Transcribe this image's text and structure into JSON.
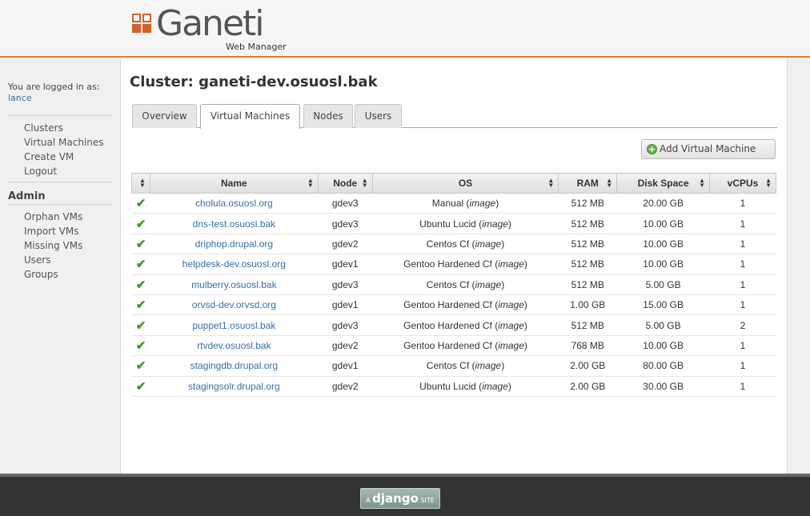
{
  "header": {
    "logo_title": "Ganeti",
    "logo_subtitle": "Web Manager"
  },
  "sidebar": {
    "login_text": "You are logged in as:",
    "username": "lance",
    "nav": [
      "Clusters",
      "Virtual Machines",
      "Create VM",
      "Logout"
    ],
    "admin_heading": "Admin",
    "admin_nav": [
      "Orphan VMs",
      "Import VMs",
      "Missing VMs",
      "Users",
      "Groups"
    ]
  },
  "main": {
    "title": "Cluster: ganeti-dev.osuosl.bak",
    "tabs": [
      {
        "label": "Overview",
        "active": false
      },
      {
        "label": "Virtual Machines",
        "active": true
      },
      {
        "label": "Nodes",
        "active": false
      },
      {
        "label": "Users",
        "active": false
      }
    ],
    "add_button_label": "Add Virtual Machine",
    "table": {
      "columns": [
        "",
        "Name",
        "Node",
        "OS",
        "RAM",
        "Disk Space",
        "vCPUs"
      ],
      "rows": [
        {
          "status": "running",
          "name": "cholula.osuosl.org",
          "node": "gdev3",
          "os": "Manual",
          "os_type": "image",
          "ram": "512 MB",
          "disk": "20.00 GB",
          "vcpus": "1"
        },
        {
          "status": "running",
          "name": "dns-test.osuosl.bak",
          "node": "gdev3",
          "os": "Ubuntu Lucid",
          "os_type": "image",
          "ram": "512 MB",
          "disk": "10.00 GB",
          "vcpus": "1"
        },
        {
          "status": "running",
          "name": "driphop.drupal.org",
          "node": "gdev2",
          "os": "Centos Cf",
          "os_type": "image",
          "ram": "512 MB",
          "disk": "10.00 GB",
          "vcpus": "1"
        },
        {
          "status": "running",
          "name": "helpdesk-dev.osuosl.org",
          "node": "gdev1",
          "os": "Gentoo Hardened Cf",
          "os_type": "image",
          "ram": "512 MB",
          "disk": "10.00 GB",
          "vcpus": "1"
        },
        {
          "status": "running",
          "name": "mulberry.osuosl.bak",
          "node": "gdev3",
          "os": "Centos Cf",
          "os_type": "image",
          "ram": "512 MB",
          "disk": "5.00 GB",
          "vcpus": "1"
        },
        {
          "status": "running",
          "name": "orvsd-dev.orvsd.org",
          "node": "gdev1",
          "os": "Gentoo Hardened Cf",
          "os_type": "image",
          "ram": "1.00 GB",
          "disk": "15.00 GB",
          "vcpus": "1"
        },
        {
          "status": "running",
          "name": "puppet1.osuosl.bak",
          "node": "gdev3",
          "os": "Gentoo Hardened Cf",
          "os_type": "image",
          "ram": "512 MB",
          "disk": "5.00 GB",
          "vcpus": "2"
        },
        {
          "status": "running",
          "name": "rtvdev.osuosl.bak",
          "node": "gdev2",
          "os": "Gentoo Hardened Cf",
          "os_type": "image",
          "ram": "768 MB",
          "disk": "10.00 GB",
          "vcpus": "1"
        },
        {
          "status": "running",
          "name": "stagingdb.drupal.org",
          "node": "gdev1",
          "os": "Centos Cf",
          "os_type": "image",
          "ram": "2.00 GB",
          "disk": "80.00 GB",
          "vcpus": "1"
        },
        {
          "status": "running",
          "name": "stagingsolr.drupal.org",
          "node": "gdev2",
          "os": "Ubuntu Lucid",
          "os_type": "image",
          "ram": "2.00 GB",
          "disk": "30.00 GB",
          "vcpus": "1"
        }
      ]
    }
  },
  "footer": {
    "badge_prefix": "A",
    "badge_brand": "django",
    "badge_suffix": "SITE"
  },
  "icons": {
    "status_running": "check-icon",
    "sort": "sort-icon",
    "add": "plus-circle-icon"
  },
  "colors": {
    "accent": "#e07a3c",
    "link": "#3b6ea5",
    "status_ok": "#3a9a2a"
  }
}
